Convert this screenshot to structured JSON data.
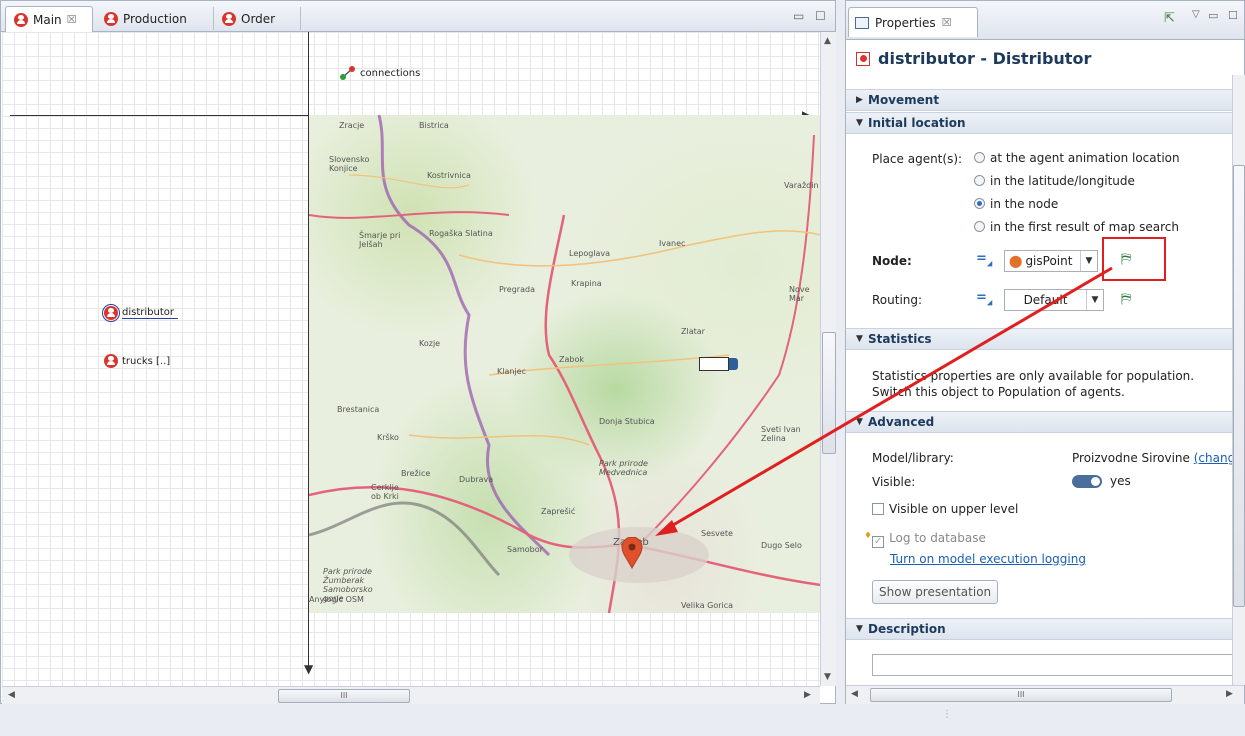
{
  "editor": {
    "tabs": [
      {
        "label": "Main",
        "close": "☒"
      },
      {
        "label": "Production"
      },
      {
        "label": "Order"
      }
    ],
    "canvas": {
      "connections_label": "connections",
      "distributor_label": "distributor",
      "trucks_label": "trucks [..]"
    },
    "map_labels": [
      "Zracje",
      "Slovensko Konjice",
      "Bistrica",
      "Kostrivnica",
      "Šmarje pri Jelšah",
      "Rogaška Slatina",
      "Ivanec",
      "Lepoglava",
      "Varaždin",
      "Nove Mar",
      "Pregrada",
      "Krapina",
      "Zlatar",
      "Kozje",
      "Klanjec",
      "Zabok",
      "Brestanica",
      "Krško",
      "Donja Stubica",
      "Sveti Ivan Zelina",
      "Brežice",
      "Dubrava",
      "Cerklje ob Krki",
      "Park prirode Medvednica",
      "Samobor",
      "Zaprešić",
      "Park prirode Žumberak Samoborsko gorje",
      "Zagreb",
      "Sesvete",
      "Dugo Selo",
      "Velika Gorica",
      "Anylogic OSM"
    ],
    "scroll_label": "III"
  },
  "properties": {
    "tab_label": "Properties",
    "tab_close": "☒",
    "object_title": "distributor - Distributor",
    "sections": {
      "movement": "Movement",
      "initial_location": "Initial location",
      "statistics": "Statistics",
      "advanced": "Advanced",
      "description": "Description"
    },
    "place_agents_label": "Place agent(s):",
    "place_options": [
      "at the agent animation location",
      "in the latitude/longitude",
      "in the node",
      "in the first result of map search"
    ],
    "selected_option_index": 2,
    "node_label": "Node:",
    "node_value": "gisPoint",
    "routing_label": "Routing:",
    "routing_value": "Default",
    "statistics_text": "Statistics properties are only available for population. Switch this object to Population of agents.",
    "model_library_label": "Model/library:",
    "model_library_value": "Proizvodne Sirovine",
    "change_link": "(chang",
    "visible_label": "Visible:",
    "visible_value": "yes",
    "visible_upper_label": "Visible on upper level",
    "log_to_db_label": "Log to database",
    "log_link": "Turn on model execution logging",
    "show_presentation": "Show presentation",
    "scroll_label": "III"
  },
  "colors": {
    "accent": "#1d3a5c",
    "highlight_box": "#e02020",
    "arrow": "#e02020",
    "agent_icon": "#d9352d",
    "link": "#1a5fb4"
  }
}
